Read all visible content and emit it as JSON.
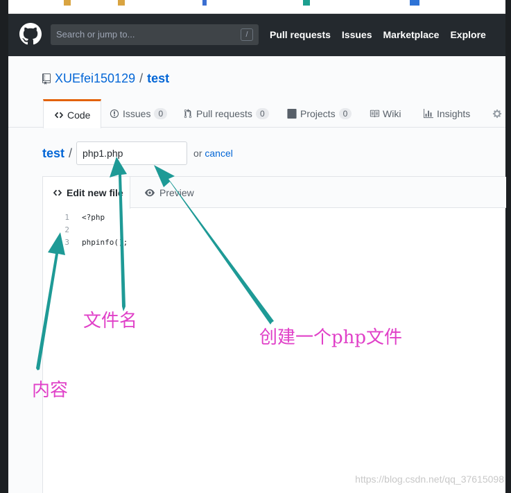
{
  "header": {
    "search_placeholder": "Search or jump to...",
    "search_shortcut": "/",
    "nav": [
      "Pull requests",
      "Issues",
      "Marketplace",
      "Explore"
    ]
  },
  "repo": {
    "owner": "XUEfei150129",
    "separator": "/",
    "name": "test"
  },
  "tabs": [
    {
      "label": "Code"
    },
    {
      "label": "Issues",
      "count": "0"
    },
    {
      "label": "Pull requests",
      "count": "0"
    },
    {
      "label": "Projects",
      "count": "0"
    },
    {
      "label": "Wiki"
    },
    {
      "label": "Insights"
    }
  ],
  "file_path": {
    "repo": "test",
    "separator": "/",
    "filename_value": "php1.php",
    "or_text": "or",
    "cancel_label": "cancel"
  },
  "editor": {
    "edit_tab": "Edit new file",
    "preview_tab": "Preview",
    "lines": [
      {
        "num": "1",
        "text": "<?php"
      },
      {
        "num": "2",
        "text": ""
      },
      {
        "num": "3",
        "text": "phpinfo();"
      }
    ]
  },
  "annotations": {
    "filename": "文件名",
    "create": "创建一个php文件",
    "content": "内容",
    "color": "#e040c8"
  },
  "watermark": "https://blog.csdn.net/qq_37615098",
  "colors": {
    "link": "#0366d6",
    "header_bg": "#24292e",
    "active_tab_accent": "#e36209",
    "arrow": "#1e9a96"
  }
}
